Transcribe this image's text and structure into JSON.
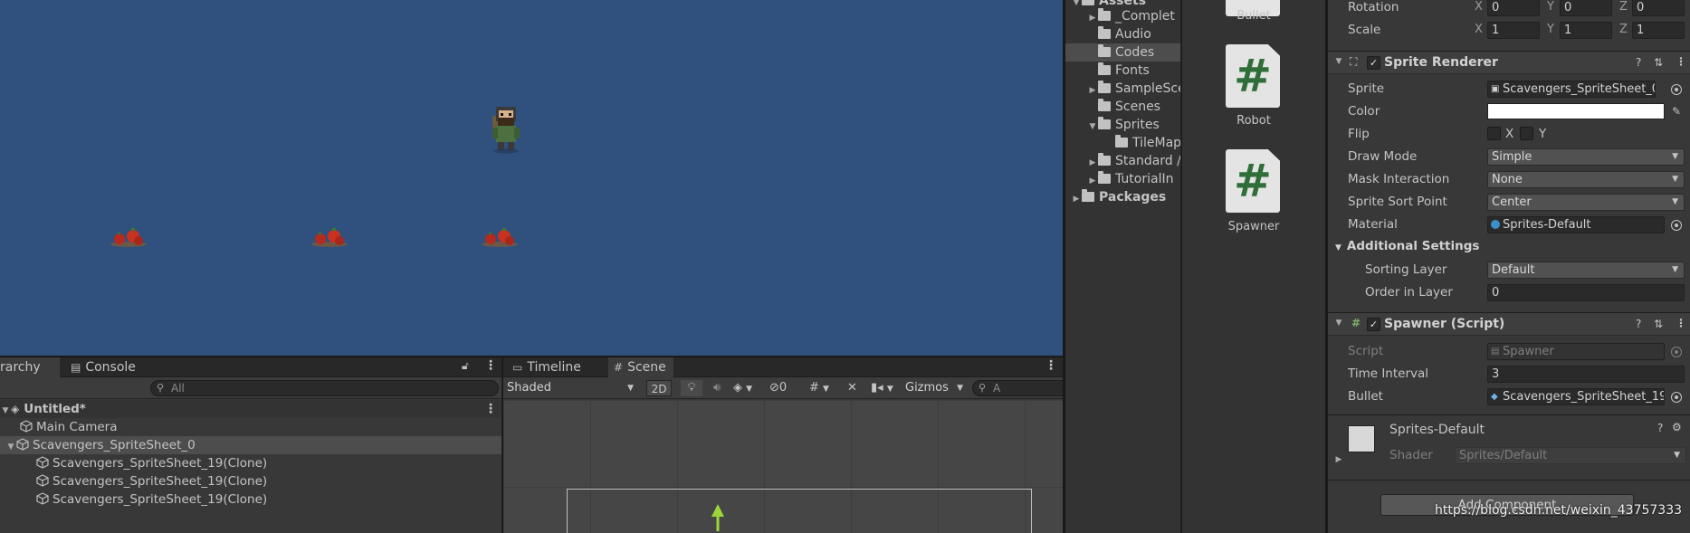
{
  "hierarchy": {
    "tab_label": "rarchy",
    "console_tab": "Console",
    "search_placeholder": "All",
    "scene_name": "Untitled*",
    "items": [
      {
        "label": "Main Camera"
      },
      {
        "label": "Scavengers_SpriteSheet_0"
      },
      {
        "label": "Scavengers_SpriteSheet_19(Clone)"
      },
      {
        "label": "Scavengers_SpriteSheet_19(Clone)"
      },
      {
        "label": "Scavengers_SpriteSheet_19(Clone)"
      }
    ]
  },
  "scene": {
    "timeline_tab": "Timeline",
    "scene_tab": "Scene",
    "shading_mode": "Shaded",
    "mode_2d": "2D",
    "hidden_count": "0",
    "gizmos_label": "Gizmos",
    "search_placeholder": "A"
  },
  "project": {
    "assets_label": "Assets",
    "folders": [
      {
        "label": "_Complet"
      },
      {
        "label": "Audio"
      },
      {
        "label": "Codes"
      },
      {
        "label": "Fonts"
      },
      {
        "label": "SampleSce"
      },
      {
        "label": "Scenes"
      },
      {
        "label": "Sprites"
      },
      {
        "label": "TileMap"
      },
      {
        "label": "Standard /"
      },
      {
        "label": "TutorialIn"
      }
    ],
    "packages_label": "Packages",
    "assets": [
      {
        "label": "Bullet"
      },
      {
        "label": "Robot"
      },
      {
        "label": "Spawner"
      }
    ]
  },
  "inspector": {
    "transform": {
      "rotation_label": "Rotation",
      "scale_label": "Scale",
      "rotation": {
        "x": "0",
        "y": "0",
        "z": "0"
      },
      "scale": {
        "x": "1",
        "y": "1",
        "z": "1"
      }
    },
    "sprite_renderer": {
      "title": "Sprite Renderer",
      "sprite_label": "Sprite",
      "sprite_value": "Scavengers_SpriteSheet_0",
      "color_label": "Color",
      "color_value": "#ffffff",
      "flip_label": "Flip",
      "flip_x": "X",
      "flip_y": "Y",
      "draw_mode_label": "Draw Mode",
      "draw_mode_value": "Simple",
      "mask_label": "Mask Interaction",
      "mask_value": "None",
      "sort_point_label": "Sprite Sort Point",
      "sort_point_value": "Center",
      "material_label": "Material",
      "material_value": "Sprites-Default",
      "additional_settings": "Additional Settings",
      "sorting_layer_label": "Sorting Layer",
      "sorting_layer_value": "Default",
      "order_label": "Order in Layer",
      "order_value": "0"
    },
    "spawner": {
      "title": "Spawner (Script)",
      "script_label": "Script",
      "script_value": "Spawner",
      "interval_label": "Time Interval",
      "interval_value": "3",
      "bullet_label": "Bullet",
      "bullet_value": "Scavengers_SpriteSheet_19"
    },
    "material": {
      "name": "Sprites-Default",
      "shader_label": "Shader",
      "shader_value": "Sprites/Default"
    },
    "add_component": "Add Component"
  },
  "watermark": "https://blog.csdn.net/weixin_43757333",
  "colors": {
    "game_background": "#30507e",
    "script_icon_hash": "#2f6e38"
  }
}
